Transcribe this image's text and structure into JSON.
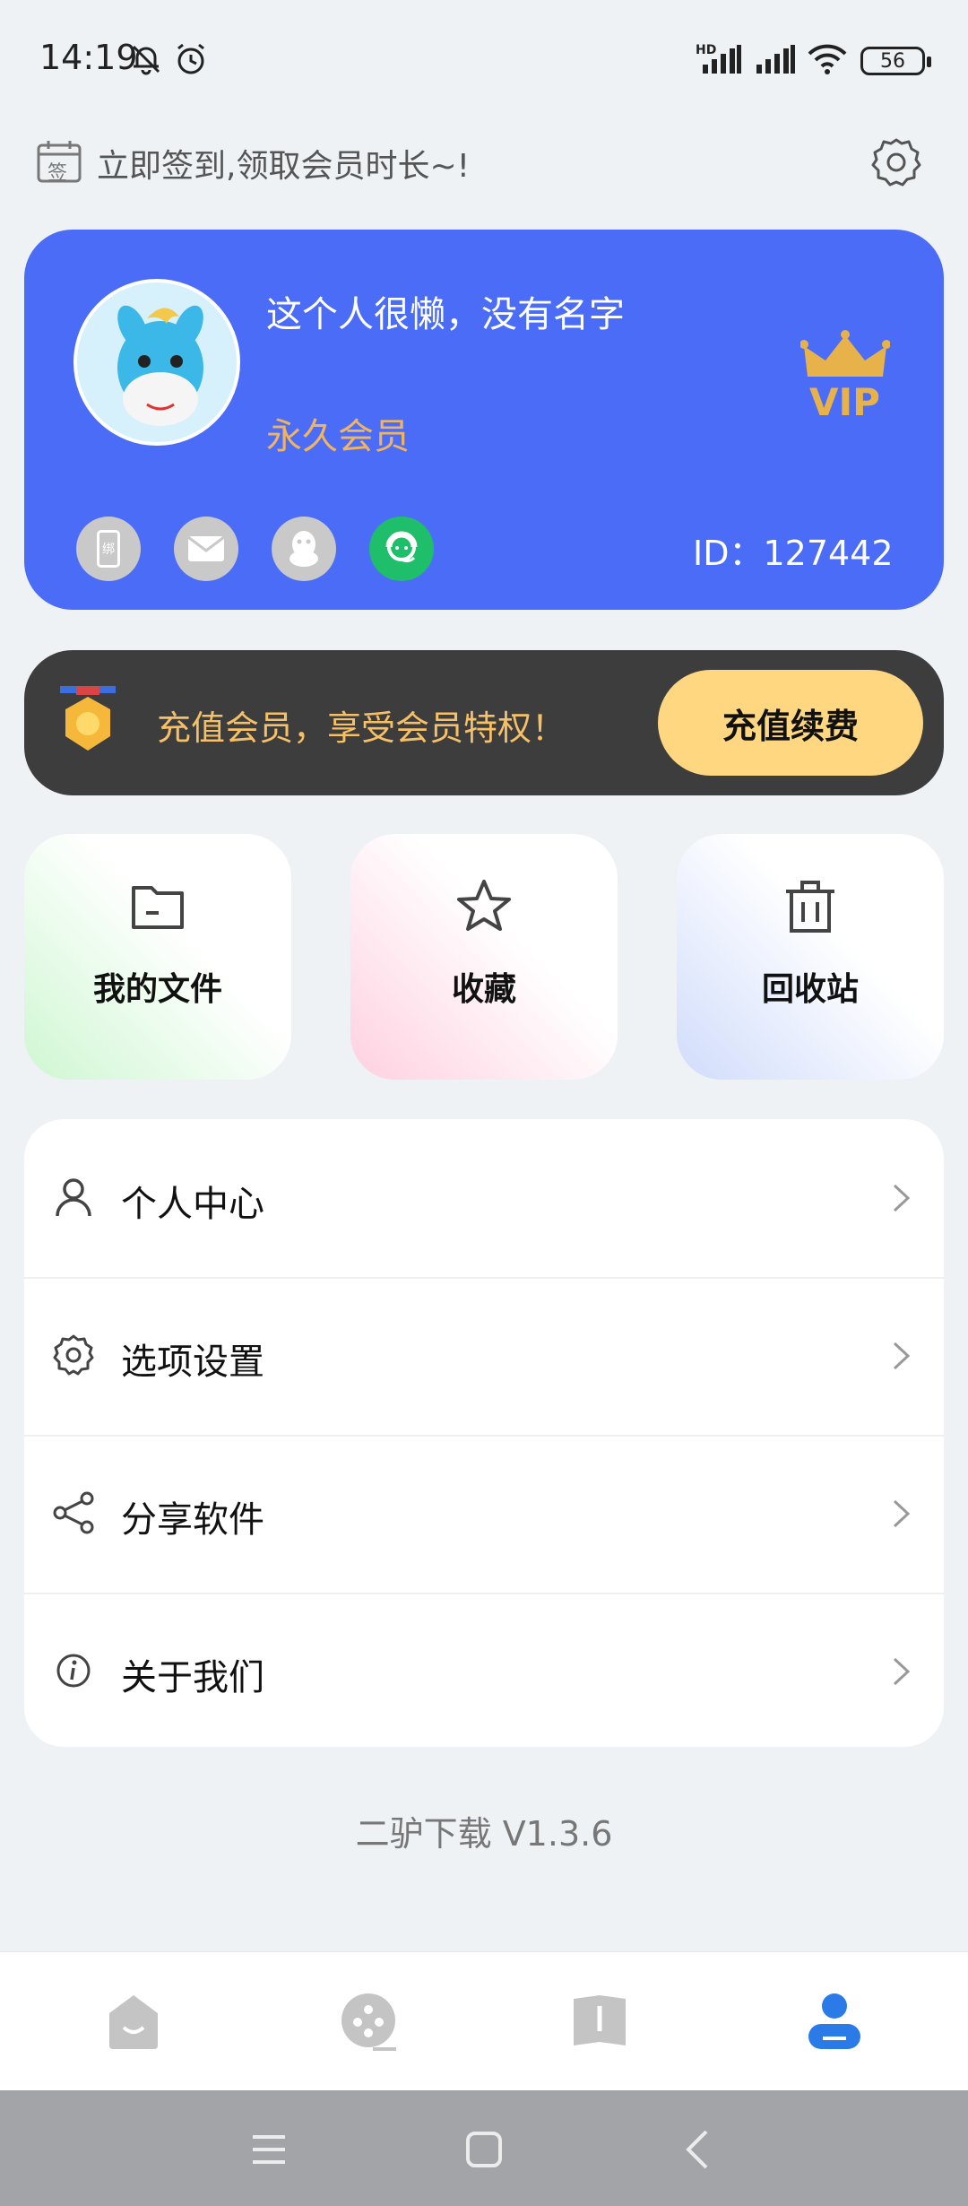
{
  "status_bar": {
    "time": "14:19",
    "battery": "56",
    "network_label": "HD",
    "icons": [
      "bell-off-icon",
      "alarm-icon",
      "signal-icon",
      "signal-icon",
      "wifi-icon",
      "battery-icon"
    ]
  },
  "signin": {
    "icon_label": "签",
    "text": "立即签到,领取会员时长~!"
  },
  "profile": {
    "name": "这个人很懒，没有名字",
    "level": "永久会员",
    "vip": "VIP",
    "id_text": "ID：127442",
    "bind_icons": [
      "phone-bind-icon",
      "email-icon",
      "qq-icon",
      "wechat-icon"
    ],
    "phone_label": "绑"
  },
  "recharge": {
    "text": "充值会员，享受会员特权！",
    "button": "充值续费"
  },
  "tiles": [
    {
      "label": "我的文件",
      "icon": "folder-icon"
    },
    {
      "label": "收藏",
      "icon": "star-icon"
    },
    {
      "label": "回收站",
      "icon": "trash-icon"
    }
  ],
  "menu": [
    {
      "label": "个人中心",
      "icon": "person-icon"
    },
    {
      "label": "选项设置",
      "icon": "settings-icon"
    },
    {
      "label": "分享软件",
      "icon": "share-icon"
    },
    {
      "label": "关于我们",
      "icon": "info-icon"
    }
  ],
  "version": "二驴下载 V1.3.6",
  "bottom_nav": [
    {
      "name": "home",
      "icon": "home-icon",
      "active": false
    },
    {
      "name": "discover",
      "icon": "discover-icon",
      "active": false
    },
    {
      "name": "library",
      "icon": "book-icon",
      "active": false
    },
    {
      "name": "profile",
      "icon": "profile-icon",
      "active": true
    }
  ],
  "colors": {
    "accent": "#4a6cf7",
    "gold": "#f0b45e",
    "nav_active": "#2a7ae8",
    "nav_inactive": "#c4c4c4"
  }
}
